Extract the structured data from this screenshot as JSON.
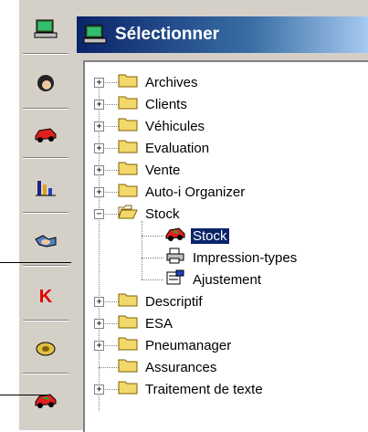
{
  "window": {
    "title": "Sélectionner",
    "title_icon": "computer-icon"
  },
  "toolbar": {
    "buttons": [
      {
        "name": "computer-icon"
      },
      {
        "name": "person-head-icon"
      },
      {
        "name": "car-icon"
      },
      {
        "name": "bar-chart-icon"
      },
      {
        "name": "handshake-icon"
      },
      {
        "name": "letter-k-icon",
        "glyph": "K"
      },
      {
        "name": "tire-icon"
      },
      {
        "name": "car-icon"
      }
    ]
  },
  "tree": {
    "items": [
      {
        "label": "Archives",
        "expander": "+"
      },
      {
        "label": "Clients",
        "expander": "+"
      },
      {
        "label": "Véhicules",
        "expander": "+"
      },
      {
        "label": "Evaluation",
        "expander": "+"
      },
      {
        "label": "Vente",
        "expander": "+"
      },
      {
        "label": "Auto-i Organizer",
        "expander": "+"
      },
      {
        "label": "Stock",
        "expander": "−",
        "children": [
          {
            "label": "Stock",
            "selected": true,
            "icon": "car-icon"
          },
          {
            "label": "Impression-types",
            "icon": "printer-icon"
          },
          {
            "label": "Ajustement",
            "icon": "adjust-icon"
          }
        ]
      },
      {
        "label": "Descriptif",
        "expander": "+"
      },
      {
        "label": "ESA",
        "expander": "+"
      },
      {
        "label": "Pneumanager",
        "expander": "+"
      },
      {
        "label": "Assurances",
        "expander": ""
      },
      {
        "label": "Traitement de texte",
        "expander": "+"
      }
    ]
  },
  "colors": {
    "titlebar_start": "#0a246a",
    "titlebar_end": "#a6caf0",
    "selection": "#0a246a",
    "folder": "#f2d86b"
  }
}
